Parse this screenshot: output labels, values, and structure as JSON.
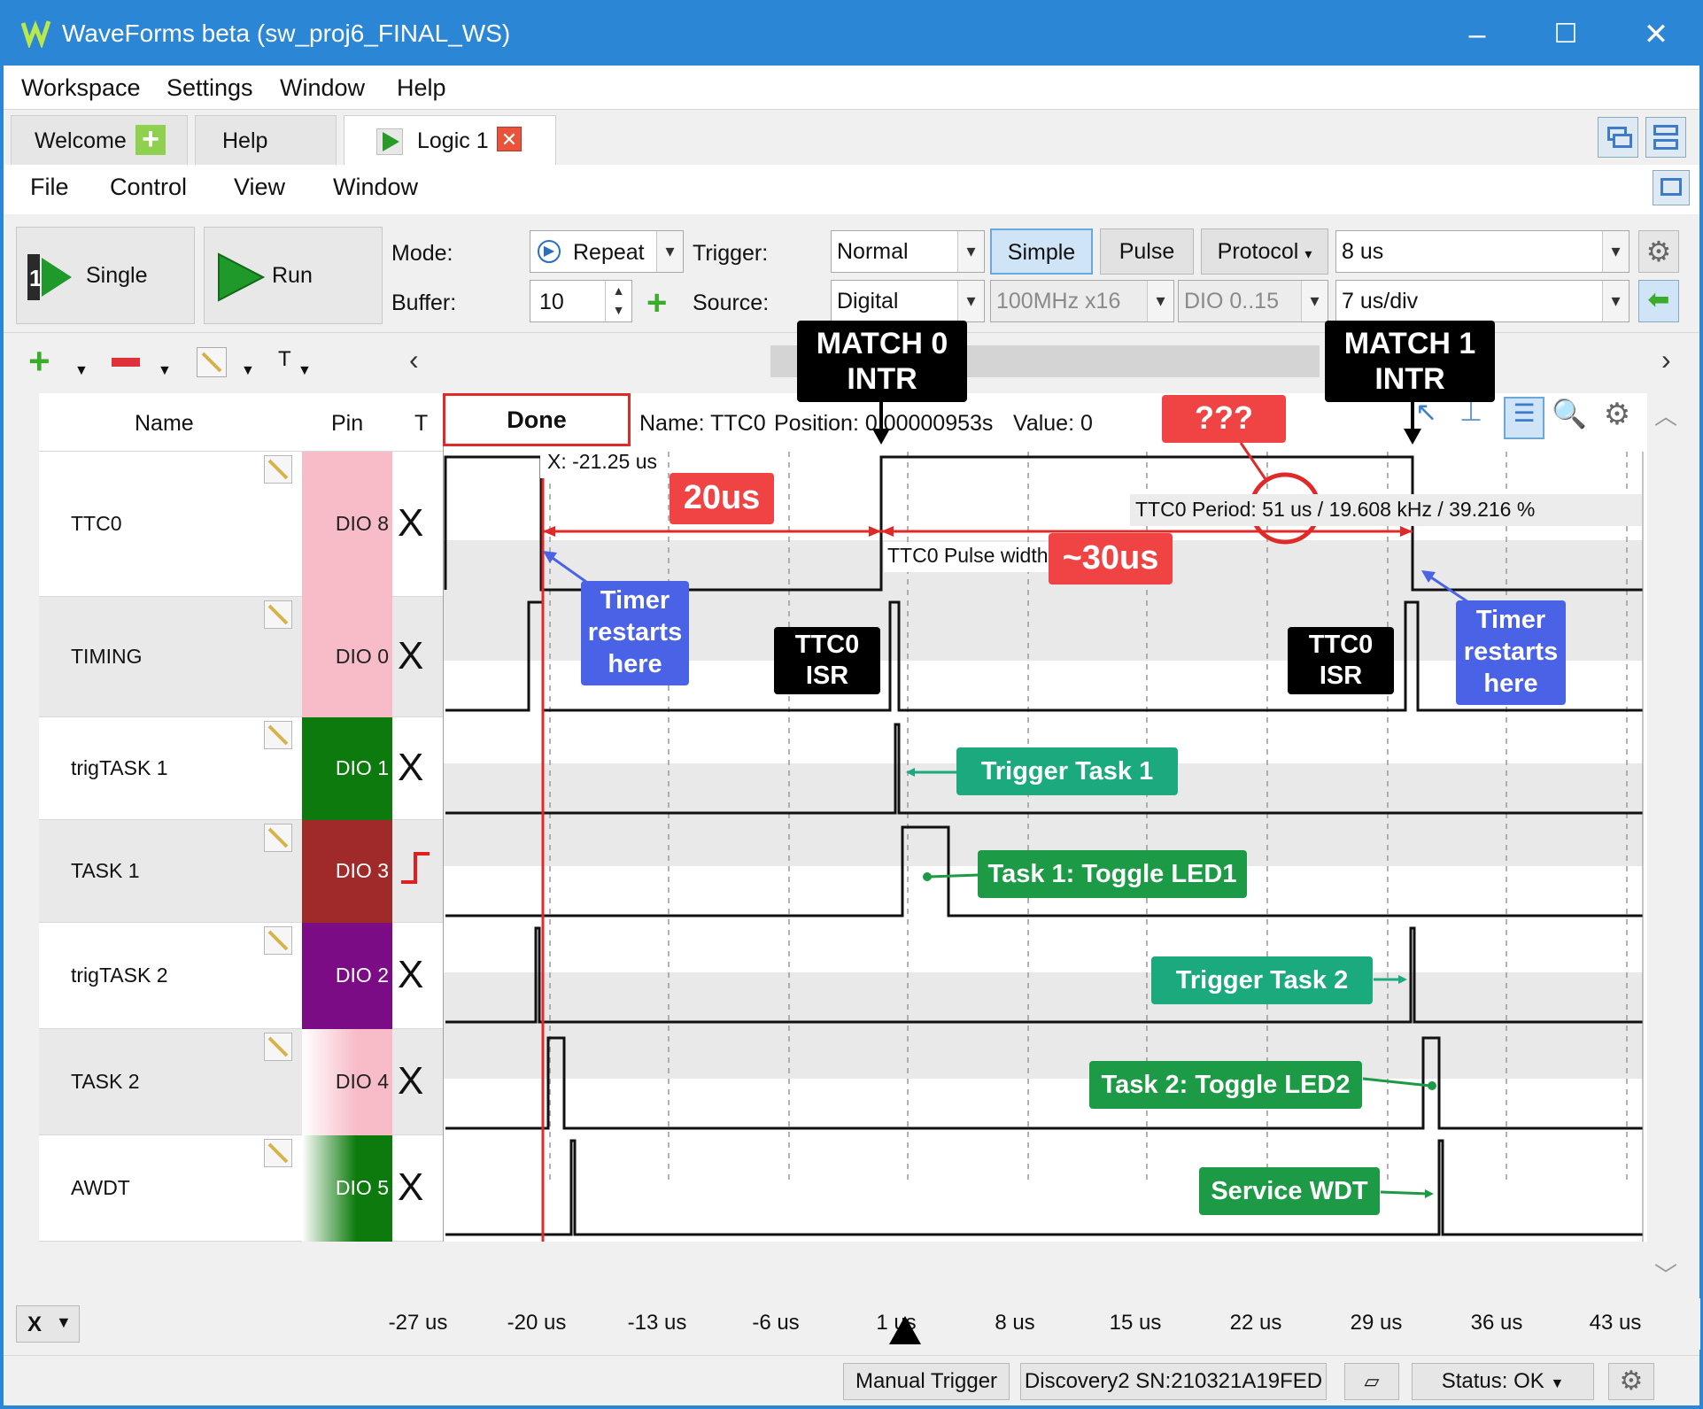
{
  "window": {
    "title": "WaveForms beta (sw_proj6_FINAL_WS)",
    "controls": [
      "–",
      "☐",
      "✕"
    ]
  },
  "menu": [
    "Workspace",
    "Settings",
    "Window",
    "Help"
  ],
  "tabs": [
    {
      "label": "Welcome"
    },
    {
      "label": "Help"
    },
    {
      "label": "Logic 1"
    }
  ],
  "submenu": [
    "File",
    "Control",
    "View",
    "Window"
  ],
  "toolbar": {
    "single_label": "Single",
    "run_label": "Run",
    "mode_label": "Mode:",
    "mode_value": "Repeat",
    "buffer_label": "Buffer:",
    "buffer_value": "10",
    "trigger_label": "Trigger:",
    "trigger_value": "Normal",
    "source_label": "Source:",
    "source_value": "Digital",
    "simple_label": "Simple",
    "pulse_label": "Pulse",
    "protocol_label": "Protocol",
    "rate_value": "100MHz x16",
    "dio_range_value": "DIO 0..15",
    "position_value": "8 us",
    "base_value": "7 us/div"
  },
  "sub_toolbar": {
    "t_label": "T"
  },
  "channel_header": {
    "name": "Name",
    "pin": "Pin",
    "t": "T"
  },
  "status_text": "Done",
  "info_bar": {
    "name": "Name: TTC0",
    "position": "Position: 0.00000953s",
    "value": "Value: 0"
  },
  "channels": [
    {
      "name": "TTC0",
      "pin": "DIO 8",
      "trigger": "X",
      "color": "#f7bcc8"
    },
    {
      "name": "TIMING",
      "pin": "DIO 0",
      "trigger": "X",
      "color": "#f7bcc8"
    },
    {
      "name": "trigTASK 1",
      "pin": "DIO 1",
      "trigger": "X",
      "color": "#0c7a0c"
    },
    {
      "name": "TASK 1",
      "pin": "DIO 3",
      "trigger": "rising",
      "color": "#a02a2a"
    },
    {
      "name": "trigTASK 2",
      "pin": "DIO 2",
      "trigger": "X",
      "color": "#7c0c86"
    },
    {
      "name": "TASK 2",
      "pin": "DIO 4",
      "trigger": "X",
      "color": "#f7bcc8"
    },
    {
      "name": "AWDT",
      "pin": "DIO 5",
      "trigger": "X",
      "color": "#0c7a0c"
    }
  ],
  "plot": {
    "cursor_x": "X: -21.25 us",
    "ttc0_period": "TTC0 Period:  51 us / 19.608 kHz / 39.216 %",
    "ttc0_pulse": "TTC0 Pulse width"
  },
  "annotations": {
    "match0": "MATCH 0\nINTR",
    "match1": "MATCH 1\nINTR",
    "qqq": "???",
    "us20": "20us",
    "us30": "~30us",
    "timer_restart_1": "Timer\nrestarts\nhere",
    "timer_restart_2": "Timer\nrestarts\nhere",
    "isr1": "TTC0\nISR",
    "isr2": "TTC0\nISR",
    "trigger_task1": "Trigger Task 1",
    "task1_toggle": "Task 1: Toggle LED1",
    "trigger_task2": "Trigger Task 2",
    "task2_toggle": "Task 2: Toggle LED2",
    "service_wdt": "Service WDT"
  },
  "xaxis": {
    "unit_selector": "X",
    "ticks": [
      "-27 us",
      "-20 us",
      "-13 us",
      "-6 us",
      "1 us",
      "8 us",
      "15 us",
      "22 us",
      "29 us",
      "36 us",
      "43 us"
    ]
  },
  "statusbar": {
    "manual_trigger": "Manual Trigger",
    "device": "Discovery2 SN:210321A19FED",
    "status": "Status: OK"
  }
}
